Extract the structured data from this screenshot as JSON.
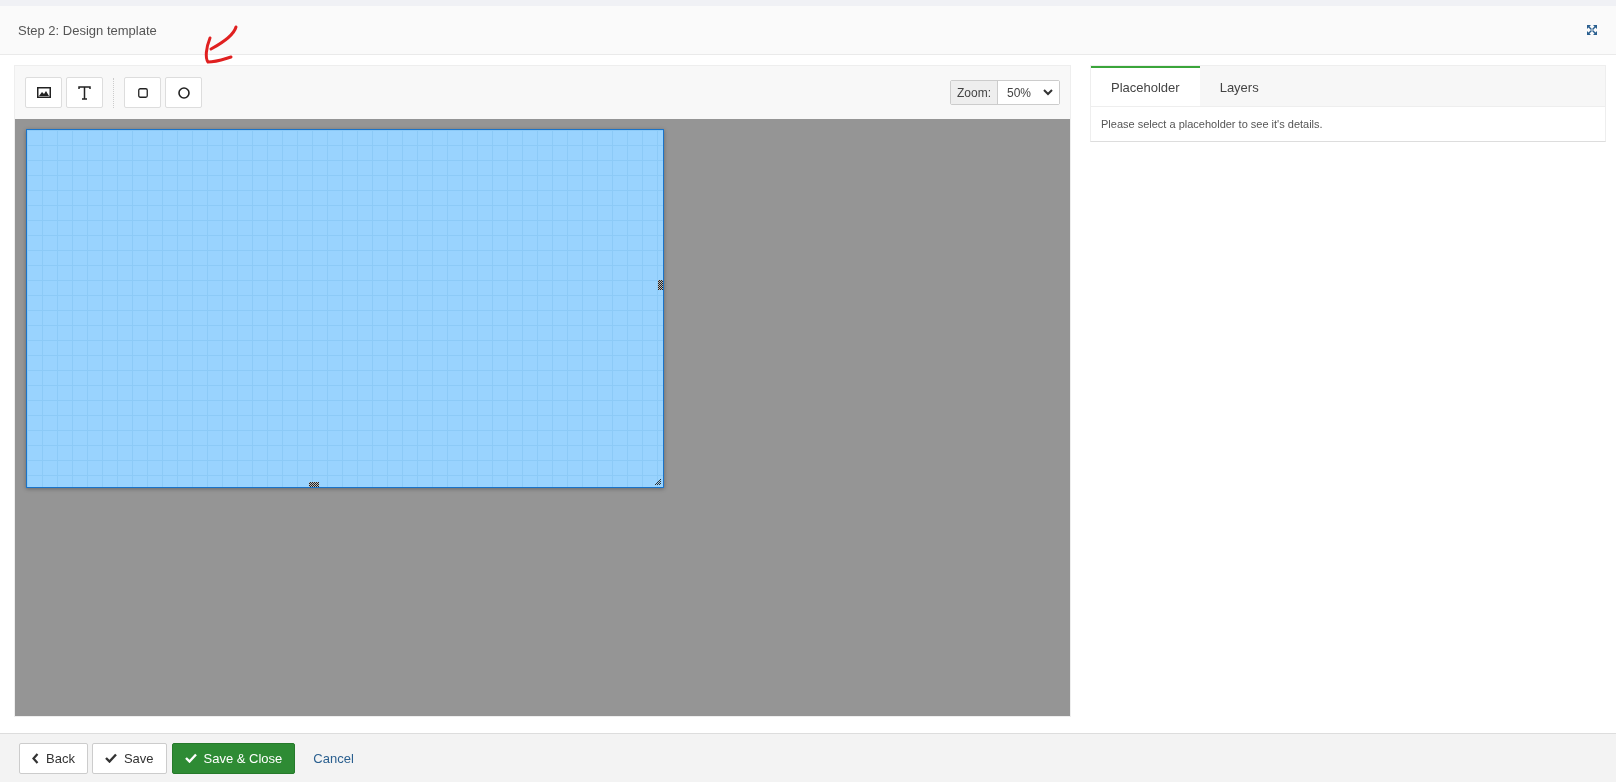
{
  "header": {
    "title": "Step 2: Design template"
  },
  "zoom": {
    "label": "Zoom:",
    "value": "50%"
  },
  "tabs": [
    {
      "label": "Placeholder",
      "selected": true
    },
    {
      "label": "Layers",
      "selected": false
    }
  ],
  "panel_message": "Please select a placeholder to see it's details.",
  "footer_buttons": [
    {
      "label": "Back",
      "kind": "back"
    },
    {
      "label": "Save",
      "kind": "save"
    },
    {
      "label": "Save & Close",
      "kind": "primary"
    },
    {
      "label": "Cancel",
      "kind": "link"
    }
  ]
}
